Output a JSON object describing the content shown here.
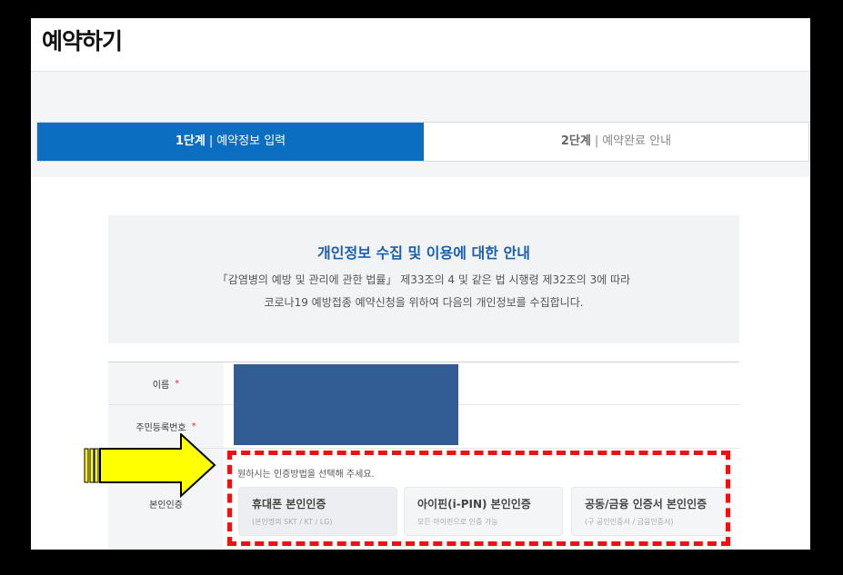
{
  "page": {
    "title": "예약하기"
  },
  "steps": [
    {
      "num": "1단계",
      "label": "예약정보 입력"
    },
    {
      "num": "2단계",
      "label": "예약완료 안내"
    }
  ],
  "notice": {
    "title": "개인정보 수집 및 이용에 대한 안내",
    "line1": "「감염병의 예방 및 관리에 관한 법률」 제33조의 4 및 같은 법 시행령 제32조의 3에 따라",
    "line2": "코로나19 예방접종 예약신청을 위하여 다음의 개인정보를 수집합니다."
  },
  "form": {
    "name_label": "이름",
    "rrn_label": "주민등록번호",
    "auth_label": "본인인증",
    "required_mark": "*",
    "auth_hint": "원하시는 인증방법을 선택해 주세요.",
    "auth_options": [
      {
        "name": "휴대폰 본인인증",
        "sub": "(본인명의 SKT / KT / LG)"
      },
      {
        "name": "아이핀(i-PIN) 본인인증",
        "sub": "모든 아이핀으로 인증 가능"
      },
      {
        "name": "공동/금융 인증서 본인인증",
        "sub": "(구 공인인증서 / 금융인증서)"
      }
    ]
  },
  "colors": {
    "step_active": "#0b6ec0",
    "notice_title": "#1a5fb0",
    "redaction": "#315d94",
    "annotation_dash": "#ee1111",
    "annotation_arrow": "#ffff00"
  },
  "icons": [
    "yellow-arrow-icon"
  ]
}
